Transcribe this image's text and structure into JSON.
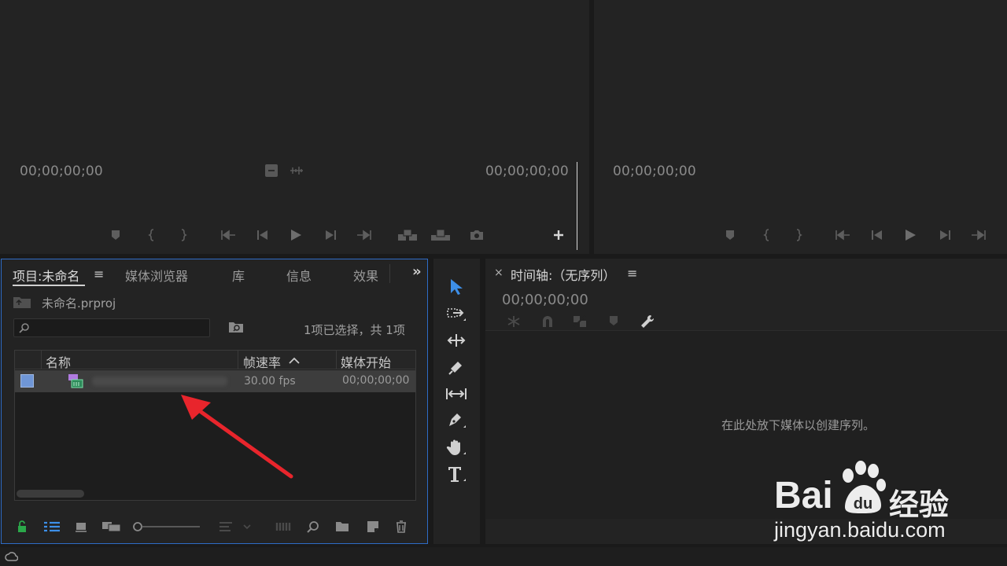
{
  "source_monitor": {
    "timecode_left": "00;00;00;00",
    "timecode_right": "00;00;00;00"
  },
  "program_monitor": {
    "timecode_left": "00;00;00;00"
  },
  "project_panel": {
    "tabs": [
      {
        "label": "项目:未命名",
        "active": true
      },
      {
        "label": "媒体浏览器"
      },
      {
        "label": "库"
      },
      {
        "label": "信息"
      },
      {
        "label": "效果"
      }
    ],
    "menu_icon": "≡",
    "overflow_icon": "»",
    "project_file": "未命名.prproj",
    "search_placeholder": "",
    "selection_status": "1项已选择，共 1项",
    "columns": [
      "名称",
      "帧速率",
      "媒体开始"
    ],
    "sort_icon": "chevron-up-icon",
    "rows": [
      {
        "name": "",
        "frame_rate": "30.00 fps",
        "media_start": "00;00;00;00"
      }
    ]
  },
  "timeline": {
    "close_icon": "×",
    "title": "时间轴:（无序列）",
    "menu_icon": "≡",
    "timecode": "00;00;00;00",
    "empty_message": "在此处放下媒体以创建序列。"
  },
  "watermark": {
    "brand": "Bai",
    "brand2": "经验",
    "url": "jingyan.baidu.com"
  },
  "colors": {
    "accent_blue": "#2e6cc6",
    "tool_selected": "#3d8fe8",
    "lock_green": "#2ba84a",
    "arrow_red": "#e8252c"
  }
}
